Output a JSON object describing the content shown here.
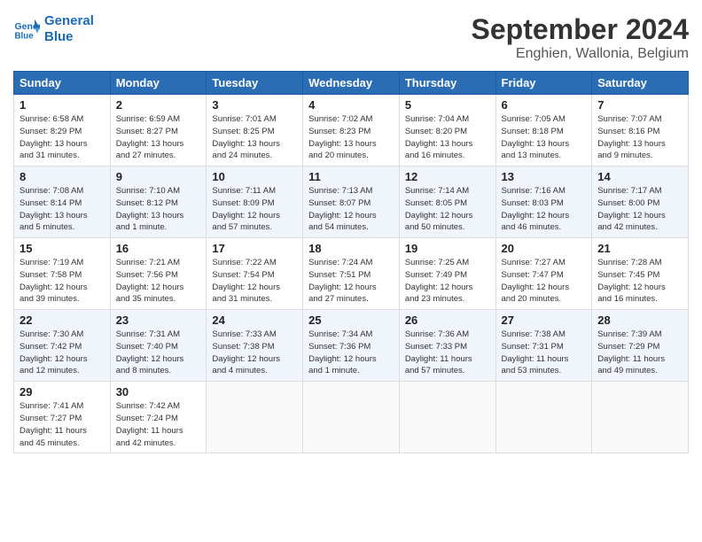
{
  "header": {
    "logo_line1": "General",
    "logo_line2": "Blue",
    "month": "September 2024",
    "location": "Enghien, Wallonia, Belgium"
  },
  "weekdays": [
    "Sunday",
    "Monday",
    "Tuesday",
    "Wednesday",
    "Thursday",
    "Friday",
    "Saturday"
  ],
  "weeks": [
    [
      {
        "day": "1",
        "info": "Sunrise: 6:58 AM\nSunset: 8:29 PM\nDaylight: 13 hours\nand 31 minutes."
      },
      {
        "day": "2",
        "info": "Sunrise: 6:59 AM\nSunset: 8:27 PM\nDaylight: 13 hours\nand 27 minutes."
      },
      {
        "day": "3",
        "info": "Sunrise: 7:01 AM\nSunset: 8:25 PM\nDaylight: 13 hours\nand 24 minutes."
      },
      {
        "day": "4",
        "info": "Sunrise: 7:02 AM\nSunset: 8:23 PM\nDaylight: 13 hours\nand 20 minutes."
      },
      {
        "day": "5",
        "info": "Sunrise: 7:04 AM\nSunset: 8:20 PM\nDaylight: 13 hours\nand 16 minutes."
      },
      {
        "day": "6",
        "info": "Sunrise: 7:05 AM\nSunset: 8:18 PM\nDaylight: 13 hours\nand 13 minutes."
      },
      {
        "day": "7",
        "info": "Sunrise: 7:07 AM\nSunset: 8:16 PM\nDaylight: 13 hours\nand 9 minutes."
      }
    ],
    [
      {
        "day": "8",
        "info": "Sunrise: 7:08 AM\nSunset: 8:14 PM\nDaylight: 13 hours\nand 5 minutes."
      },
      {
        "day": "9",
        "info": "Sunrise: 7:10 AM\nSunset: 8:12 PM\nDaylight: 13 hours\nand 1 minute."
      },
      {
        "day": "10",
        "info": "Sunrise: 7:11 AM\nSunset: 8:09 PM\nDaylight: 12 hours\nand 57 minutes."
      },
      {
        "day": "11",
        "info": "Sunrise: 7:13 AM\nSunset: 8:07 PM\nDaylight: 12 hours\nand 54 minutes."
      },
      {
        "day": "12",
        "info": "Sunrise: 7:14 AM\nSunset: 8:05 PM\nDaylight: 12 hours\nand 50 minutes."
      },
      {
        "day": "13",
        "info": "Sunrise: 7:16 AM\nSunset: 8:03 PM\nDaylight: 12 hours\nand 46 minutes."
      },
      {
        "day": "14",
        "info": "Sunrise: 7:17 AM\nSunset: 8:00 PM\nDaylight: 12 hours\nand 42 minutes."
      }
    ],
    [
      {
        "day": "15",
        "info": "Sunrise: 7:19 AM\nSunset: 7:58 PM\nDaylight: 12 hours\nand 39 minutes."
      },
      {
        "day": "16",
        "info": "Sunrise: 7:21 AM\nSunset: 7:56 PM\nDaylight: 12 hours\nand 35 minutes."
      },
      {
        "day": "17",
        "info": "Sunrise: 7:22 AM\nSunset: 7:54 PM\nDaylight: 12 hours\nand 31 minutes."
      },
      {
        "day": "18",
        "info": "Sunrise: 7:24 AM\nSunset: 7:51 PM\nDaylight: 12 hours\nand 27 minutes."
      },
      {
        "day": "19",
        "info": "Sunrise: 7:25 AM\nSunset: 7:49 PM\nDaylight: 12 hours\nand 23 minutes."
      },
      {
        "day": "20",
        "info": "Sunrise: 7:27 AM\nSunset: 7:47 PM\nDaylight: 12 hours\nand 20 minutes."
      },
      {
        "day": "21",
        "info": "Sunrise: 7:28 AM\nSunset: 7:45 PM\nDaylight: 12 hours\nand 16 minutes."
      }
    ],
    [
      {
        "day": "22",
        "info": "Sunrise: 7:30 AM\nSunset: 7:42 PM\nDaylight: 12 hours\nand 12 minutes."
      },
      {
        "day": "23",
        "info": "Sunrise: 7:31 AM\nSunset: 7:40 PM\nDaylight: 12 hours\nand 8 minutes."
      },
      {
        "day": "24",
        "info": "Sunrise: 7:33 AM\nSunset: 7:38 PM\nDaylight: 12 hours\nand 4 minutes."
      },
      {
        "day": "25",
        "info": "Sunrise: 7:34 AM\nSunset: 7:36 PM\nDaylight: 12 hours\nand 1 minute."
      },
      {
        "day": "26",
        "info": "Sunrise: 7:36 AM\nSunset: 7:33 PM\nDaylight: 11 hours\nand 57 minutes."
      },
      {
        "day": "27",
        "info": "Sunrise: 7:38 AM\nSunset: 7:31 PM\nDaylight: 11 hours\nand 53 minutes."
      },
      {
        "day": "28",
        "info": "Sunrise: 7:39 AM\nSunset: 7:29 PM\nDaylight: 11 hours\nand 49 minutes."
      }
    ],
    [
      {
        "day": "29",
        "info": "Sunrise: 7:41 AM\nSunset: 7:27 PM\nDaylight: 11 hours\nand 45 minutes."
      },
      {
        "day": "30",
        "info": "Sunrise: 7:42 AM\nSunset: 7:24 PM\nDaylight: 11 hours\nand 42 minutes."
      },
      {
        "day": "",
        "info": ""
      },
      {
        "day": "",
        "info": ""
      },
      {
        "day": "",
        "info": ""
      },
      {
        "day": "",
        "info": ""
      },
      {
        "day": "",
        "info": ""
      }
    ]
  ]
}
